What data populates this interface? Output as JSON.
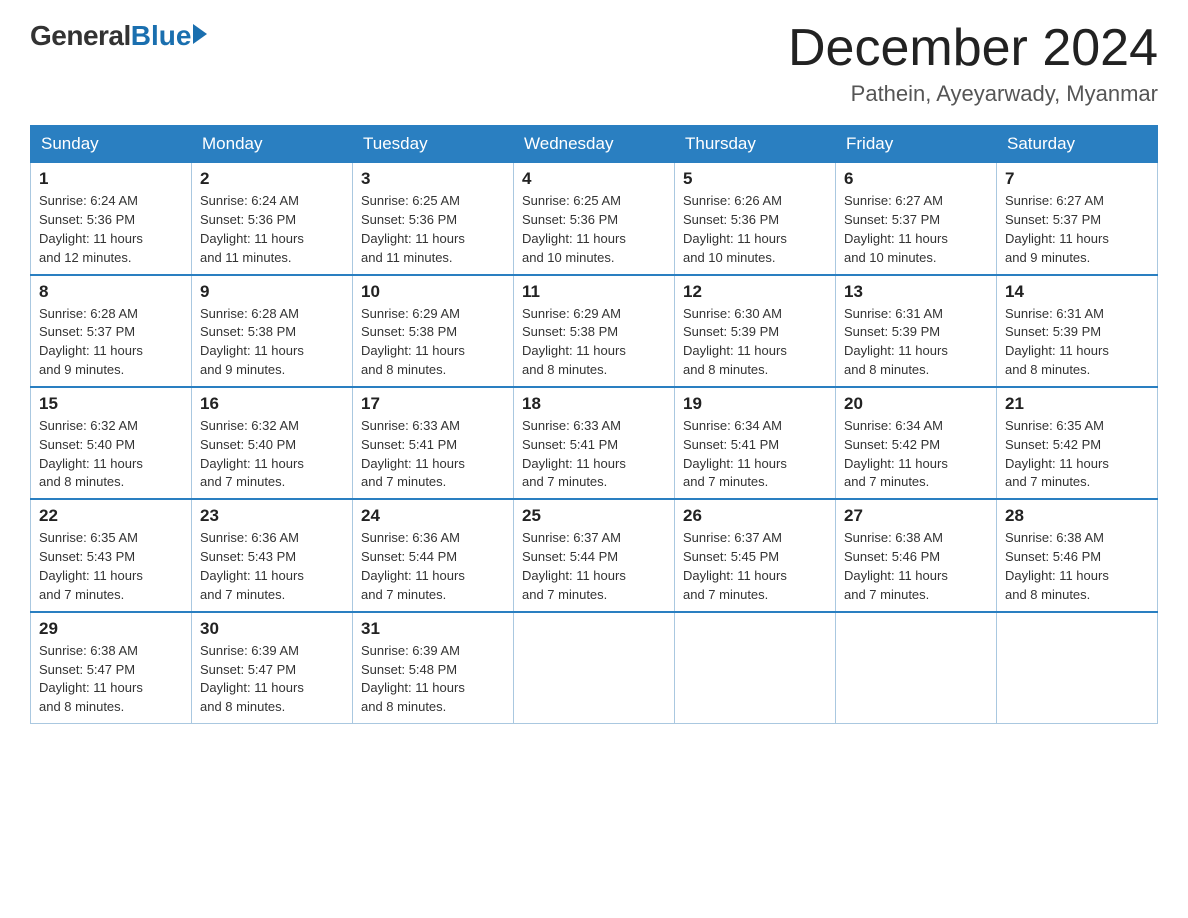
{
  "header": {
    "logo": {
      "general": "General",
      "blue": "Blue"
    },
    "title": "December 2024",
    "location": "Pathein, Ayeyarwady, Myanmar"
  },
  "days_of_week": [
    "Sunday",
    "Monday",
    "Tuesday",
    "Wednesday",
    "Thursday",
    "Friday",
    "Saturday"
  ],
  "weeks": [
    [
      {
        "day": "1",
        "sunrise": "6:24 AM",
        "sunset": "5:36 PM",
        "daylight": "11 hours and 12 minutes."
      },
      {
        "day": "2",
        "sunrise": "6:24 AM",
        "sunset": "5:36 PM",
        "daylight": "11 hours and 11 minutes."
      },
      {
        "day": "3",
        "sunrise": "6:25 AM",
        "sunset": "5:36 PM",
        "daylight": "11 hours and 11 minutes."
      },
      {
        "day": "4",
        "sunrise": "6:25 AM",
        "sunset": "5:36 PM",
        "daylight": "11 hours and 10 minutes."
      },
      {
        "day": "5",
        "sunrise": "6:26 AM",
        "sunset": "5:36 PM",
        "daylight": "11 hours and 10 minutes."
      },
      {
        "day": "6",
        "sunrise": "6:27 AM",
        "sunset": "5:37 PM",
        "daylight": "11 hours and 10 minutes."
      },
      {
        "day": "7",
        "sunrise": "6:27 AM",
        "sunset": "5:37 PM",
        "daylight": "11 hours and 9 minutes."
      }
    ],
    [
      {
        "day": "8",
        "sunrise": "6:28 AM",
        "sunset": "5:37 PM",
        "daylight": "11 hours and 9 minutes."
      },
      {
        "day": "9",
        "sunrise": "6:28 AM",
        "sunset": "5:38 PM",
        "daylight": "11 hours and 9 minutes."
      },
      {
        "day": "10",
        "sunrise": "6:29 AM",
        "sunset": "5:38 PM",
        "daylight": "11 hours and 8 minutes."
      },
      {
        "day": "11",
        "sunrise": "6:29 AM",
        "sunset": "5:38 PM",
        "daylight": "11 hours and 8 minutes."
      },
      {
        "day": "12",
        "sunrise": "6:30 AM",
        "sunset": "5:39 PM",
        "daylight": "11 hours and 8 minutes."
      },
      {
        "day": "13",
        "sunrise": "6:31 AM",
        "sunset": "5:39 PM",
        "daylight": "11 hours and 8 minutes."
      },
      {
        "day": "14",
        "sunrise": "6:31 AM",
        "sunset": "5:39 PM",
        "daylight": "11 hours and 8 minutes."
      }
    ],
    [
      {
        "day": "15",
        "sunrise": "6:32 AM",
        "sunset": "5:40 PM",
        "daylight": "11 hours and 8 minutes."
      },
      {
        "day": "16",
        "sunrise": "6:32 AM",
        "sunset": "5:40 PM",
        "daylight": "11 hours and 7 minutes."
      },
      {
        "day": "17",
        "sunrise": "6:33 AM",
        "sunset": "5:41 PM",
        "daylight": "11 hours and 7 minutes."
      },
      {
        "day": "18",
        "sunrise": "6:33 AM",
        "sunset": "5:41 PM",
        "daylight": "11 hours and 7 minutes."
      },
      {
        "day": "19",
        "sunrise": "6:34 AM",
        "sunset": "5:41 PM",
        "daylight": "11 hours and 7 minutes."
      },
      {
        "day": "20",
        "sunrise": "6:34 AM",
        "sunset": "5:42 PM",
        "daylight": "11 hours and 7 minutes."
      },
      {
        "day": "21",
        "sunrise": "6:35 AM",
        "sunset": "5:42 PM",
        "daylight": "11 hours and 7 minutes."
      }
    ],
    [
      {
        "day": "22",
        "sunrise": "6:35 AM",
        "sunset": "5:43 PM",
        "daylight": "11 hours and 7 minutes."
      },
      {
        "day": "23",
        "sunrise": "6:36 AM",
        "sunset": "5:43 PM",
        "daylight": "11 hours and 7 minutes."
      },
      {
        "day": "24",
        "sunrise": "6:36 AM",
        "sunset": "5:44 PM",
        "daylight": "11 hours and 7 minutes."
      },
      {
        "day": "25",
        "sunrise": "6:37 AM",
        "sunset": "5:44 PM",
        "daylight": "11 hours and 7 minutes."
      },
      {
        "day": "26",
        "sunrise": "6:37 AM",
        "sunset": "5:45 PM",
        "daylight": "11 hours and 7 minutes."
      },
      {
        "day": "27",
        "sunrise": "6:38 AM",
        "sunset": "5:46 PM",
        "daylight": "11 hours and 7 minutes."
      },
      {
        "day": "28",
        "sunrise": "6:38 AM",
        "sunset": "5:46 PM",
        "daylight": "11 hours and 8 minutes."
      }
    ],
    [
      {
        "day": "29",
        "sunrise": "6:38 AM",
        "sunset": "5:47 PM",
        "daylight": "11 hours and 8 minutes."
      },
      {
        "day": "30",
        "sunrise": "6:39 AM",
        "sunset": "5:47 PM",
        "daylight": "11 hours and 8 minutes."
      },
      {
        "day": "31",
        "sunrise": "6:39 AM",
        "sunset": "5:48 PM",
        "daylight": "11 hours and 8 minutes."
      },
      null,
      null,
      null,
      null
    ]
  ],
  "labels": {
    "sunrise": "Sunrise:",
    "sunset": "Sunset:",
    "daylight": "Daylight:"
  }
}
